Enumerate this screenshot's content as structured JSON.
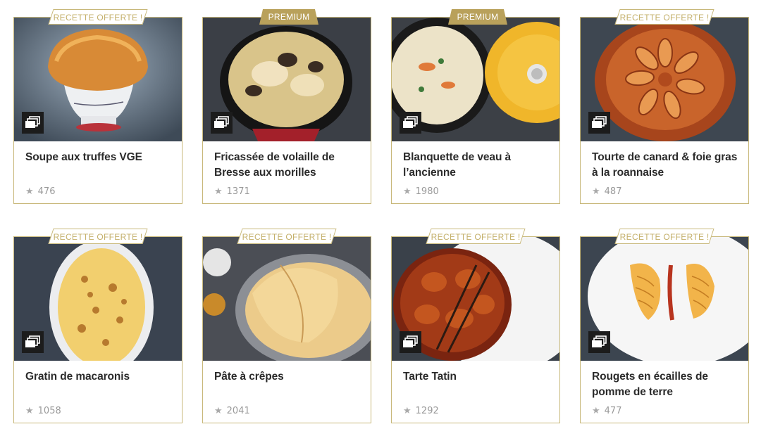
{
  "recipes": [
    {
      "title": "Soupe aux truffes VGE",
      "rating": "476",
      "tag": "RECETTE OFFERTE !",
      "tag_type": "offer",
      "icon": "gallery-icon",
      "image": "truffle-soup-photo"
    },
    {
      "title": "Fricassée de volaille de Bresse aux morilles",
      "rating": "1371",
      "tag": "PREMIUM",
      "tag_type": "premium",
      "icon": "gallery-icon",
      "image": "chicken-fricassee-photo"
    },
    {
      "title": "Blanquette de veau à l’ancienne",
      "rating": "1980",
      "tag": "PREMIUM",
      "tag_type": "premium",
      "icon": "gallery-icon",
      "image": "veal-blanquette-photo"
    },
    {
      "title": "Tourte de canard & foie gras à la roannaise",
      "rating": "487",
      "tag": "RECETTE OFFERTE !",
      "tag_type": "offer",
      "icon": "gallery-icon",
      "image": "duck-pie-photo"
    },
    {
      "title": "Gratin de macaronis",
      "rating": "1058",
      "tag": "RECETTE OFFERTE !",
      "tag_type": "offer",
      "icon": "gallery-icon",
      "image": "macaroni-gratin-photo"
    },
    {
      "title": "Pâte à crêpes",
      "rating": "2041",
      "tag": "RECETTE OFFERTE !",
      "tag_type": "offer",
      "icon": "gallery-icon",
      "image": "crepes-photo"
    },
    {
      "title": "Tarte Tatin",
      "rating": "1292",
      "tag": "RECETTE OFFERTE !",
      "tag_type": "offer",
      "icon": "gallery-icon",
      "image": "tarte-tatin-photo"
    },
    {
      "title": "Rougets en écailles de pomme de terre",
      "rating": "477",
      "tag": "RECETTE OFFERTE !",
      "tag_type": "offer",
      "icon": "gallery-icon",
      "image": "red-mullet-photo"
    }
  ],
  "rating_icon": "star-icon",
  "colors": {
    "border": "#c8b87a",
    "premium_bg": "#b9a15b",
    "offer_text": "#c4b06b",
    "title": "#2b2b2b",
    "rating": "#9a9a9a"
  }
}
